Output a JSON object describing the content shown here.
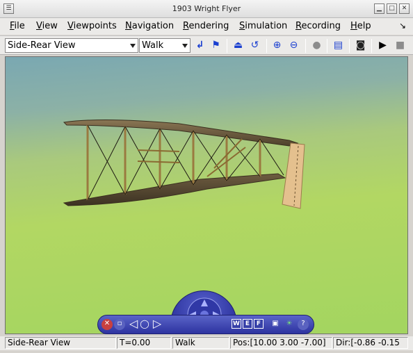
{
  "window": {
    "title": "1903 Wright Flyer"
  },
  "menubar": {
    "items": [
      "File",
      "View",
      "Viewpoints",
      "Navigation",
      "Rendering",
      "Simulation",
      "Recording",
      "Help"
    ]
  },
  "toolbar": {
    "viewpoint_value": "Side-Rear View",
    "navigation_mode_value": "Walk",
    "icons": [
      "return-icon",
      "flag-icon",
      "straighten-icon",
      "undo-icon",
      "zoom-in-icon",
      "zoom-out-icon",
      "record-dot-icon",
      "clipboard-icon",
      "camera-icon",
      "play-icon",
      "stop-icon"
    ]
  },
  "dashboard": {
    "wef_labels": [
      "W",
      "E",
      "F"
    ],
    "help_label": "?"
  },
  "statusbar": {
    "viewpoint": "Side-Rear View",
    "time": "T=0.00",
    "mode": "Walk",
    "position": "Pos:[10.00 3.00 -7.00]",
    "direction": "Dir:[-0.86 -0.15"
  },
  "colors": {
    "sky": "#7aa8b2",
    "ground": "#a3d560",
    "dashboard": "#3640a8",
    "wing": "#6b5a3e"
  }
}
